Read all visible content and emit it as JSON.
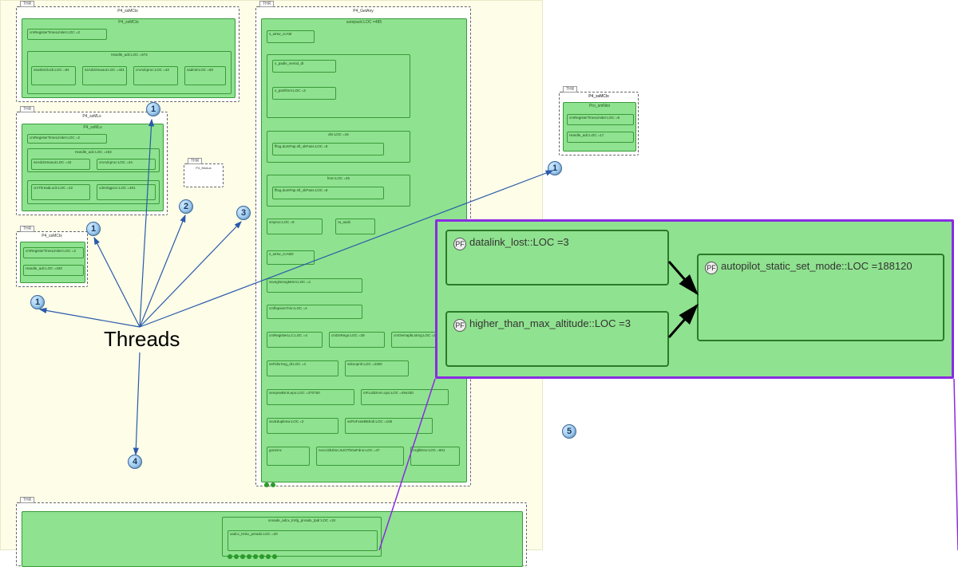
{
  "labels": {
    "threads": "Threads",
    "tab": "THR"
  },
  "markers": {
    "m1a": "1",
    "m1b": "1",
    "m1c": "1",
    "m1d": "1",
    "m2": "2",
    "m3": "3",
    "m4": "4",
    "m5": "5"
  },
  "blocks": {
    "b1": {
      "title": "P4_ssMCtx",
      "g1": "cmRegisterTimeLimiter:LOC =2",
      "g2": "Handle_adc:LOC =572",
      "s1": "sswriteClock:LOC =94",
      "s2": "ssAdcDmaout:LOC =401",
      "s3": "cmAdcproc:LOC =42",
      "s4": "sadcW:LOC =50"
    },
    "b2": {
      "title": "P4_ssMLs",
      "g1": "cmRegisterTimeLimiter:LOC =2",
      "g2": "Handle_adc:LOC =192",
      "s1": "ssAdcDmaout:LOC =42",
      "s2": "cmAdcproc:LOC =44",
      "s3": "cmThreadLock:LOC =42",
      "s4": "cdmSigproc:LOC =401"
    },
    "b3": {
      "title": "P4_ssMCtx",
      "g1": "cmRegisterTimeLimiter:LOC =2",
      "g2": "Handle_adc:LOC =340"
    },
    "b4": {
      "title": "P4_MxAux"
    },
    "b5": {
      "title": "P4_GetAny",
      "g1": "ssrepack:LOC =485",
      "s1": "s_wHw_ccAM",
      "s2": "s_padls_semid_dt",
      "s3": "s_paOfmm:LOC =2",
      "gn1": "dm:LOC =15",
      "gn1s1": "fftxg.dumPap.sft_skPass:LOC =8",
      "gn2": "fmm:LOC =45",
      "gn2s1": "fftxg.dumPap.sft_skPass:LOC =8",
      "row1a": "smproc:LOC =8",
      "row1b": "ra_asds",
      "s4": "s_wHw_ccAM2",
      "r1": "ssvegNnmgMmm:LOC =4",
      "r2": "cmflapsemTmn:LOC =4",
      "r3a": "cmRegisterLLC:LOC =4",
      "r3b": "cmDsRego:LOC =28",
      "r3c": "cmOemapbLstrng:LOC =2",
      "r4a": "ssFtdsrXng_dt:LOC =4",
      "r4b": "ssknopnh:LOC =2300",
      "r5a": "semprwBrnrLepo:LOC =370750",
      "r5b": "mFLubDmm.opo:LOC =494430",
      "r6a": "ssvEdupkmw:LOC =2",
      "r6b": "ssFtvFxseBEEnk:LOC =106",
      "r7a": "gonemc",
      "r7b": "nxcccldUbncJsJOTbOaFdno:LOC =47",
      "r7c": "ArglkDno:LOC =601"
    },
    "b6": {
      "title": "P4_ssMCtx",
      "g1": "Pro_smNtxi",
      "g2": "cmRegisterTimeLimiter:LOC =8",
      "g3": "Handle_adc:LOC =17"
    },
    "b7": {
      "g1": "xnnade_adcx_trnfg_pnradx_tpdr:LOC =34",
      "g2": "xadcx_trnkx_pnradx:LOC =20"
    }
  },
  "detail": {
    "box1": "datalink_lost::LOC =3",
    "box2": "higher_than_max_altitude::LOC =3",
    "box3": "autopilot_static_set_mode::LOC =188120",
    "pf": "PF"
  }
}
